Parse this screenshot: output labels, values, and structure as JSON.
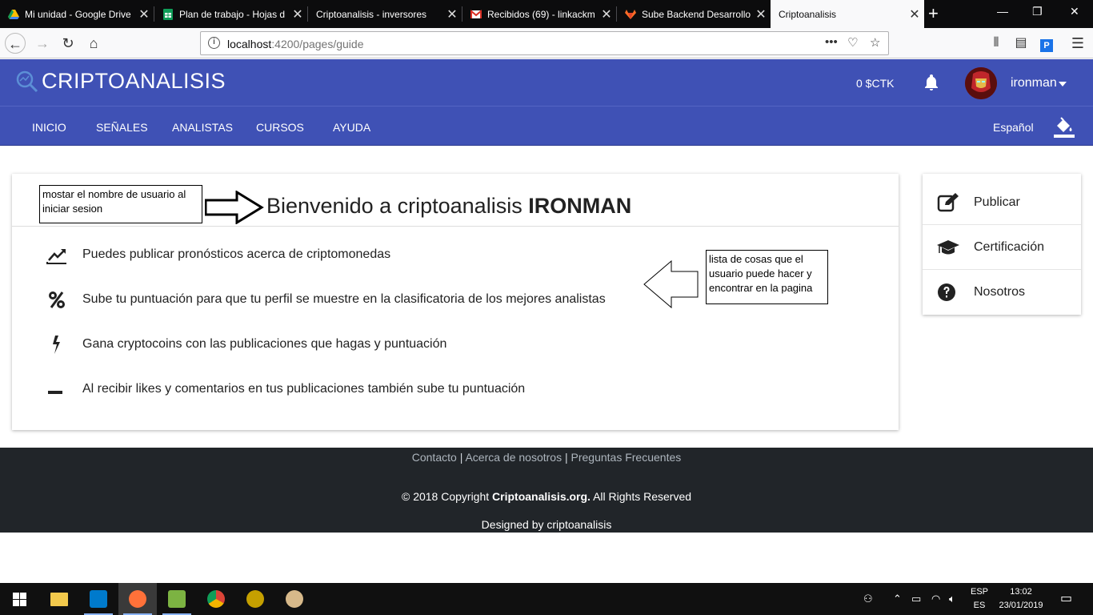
{
  "browser": {
    "tabs": [
      {
        "label": "Mi unidad - Google Drive",
        "icon": "google-drive-icon",
        "color": "#fbbc04"
      },
      {
        "label": "Plan de trabajo - Hojas d",
        "icon": "google-sheets-icon",
        "color": "#0f9d58"
      },
      {
        "label": "Criptoanalisis - inversores",
        "icon": "page-icon",
        "color": "#0c0c0d"
      },
      {
        "label": "Recibidos (69) - linkackm",
        "icon": "gmail-icon",
        "color": "#d93025"
      },
      {
        "label": "Sube Backend Desarrollo",
        "icon": "gitlab-icon",
        "color": "#fc6d26"
      },
      {
        "label": "Criptoanalisis",
        "icon": "page-icon",
        "color": "#f9f9fa"
      }
    ],
    "url_host": "localhost",
    "url_rest": ":4200/pages/guide"
  },
  "header": {
    "brand": "CRIPTOANALISIS",
    "balance": "0 $CTK",
    "username": "ironman",
    "accent": "#3f51b5"
  },
  "nav": {
    "items": [
      "INICIO",
      "SEÑALES",
      "ANALISTAS",
      "CURSOS",
      "AYUDA"
    ],
    "language": "Español"
  },
  "main": {
    "welcome_prefix": "Bienvenido a criptoanalisis",
    "welcome_name": "IRONMAN",
    "features": [
      {
        "icon": "trending-up-icon",
        "text": "Puedes publicar pronósticos acerca de criptomonedas"
      },
      {
        "icon": "percent-icon",
        "text": "Sube tu puntuación para que tu perfil se muestre en la clasificatoria de los mejores analistas"
      },
      {
        "icon": "bolt-icon",
        "text": "Gana cryptocoins con las publicaciones que hagas y puntuación"
      },
      {
        "icon": "minus-icon",
        "text": "Al recibir likes y comentarios en tus publicaciones también sube tu puntuación"
      }
    ]
  },
  "annotations": {
    "note1": "mostar el nombre de usuario al iniciar sesion",
    "note2": "lista de cosas que el usuario puede hacer y encontrar en la pagina"
  },
  "side_menu": [
    {
      "icon": "edit-icon",
      "label": "Publicar"
    },
    {
      "icon": "graduation-cap-icon",
      "label": "Certificación"
    },
    {
      "icon": "question-circle-icon",
      "label": "Nosotros"
    }
  ],
  "footer": {
    "links": [
      "Contacto",
      "Acerca de nosotros",
      "Preguntas Frecuentes"
    ],
    "copy_prefix": "© 2018 Copyright",
    "copy_brand": "Criptoanalisis.org.",
    "copy_suffix": "All Rights Reserved",
    "designed": "Designed by criptoanalisis"
  },
  "taskbar": {
    "lang1": "ESP",
    "lang2": "ES",
    "time": "13:02",
    "date": "23/01/2019"
  }
}
